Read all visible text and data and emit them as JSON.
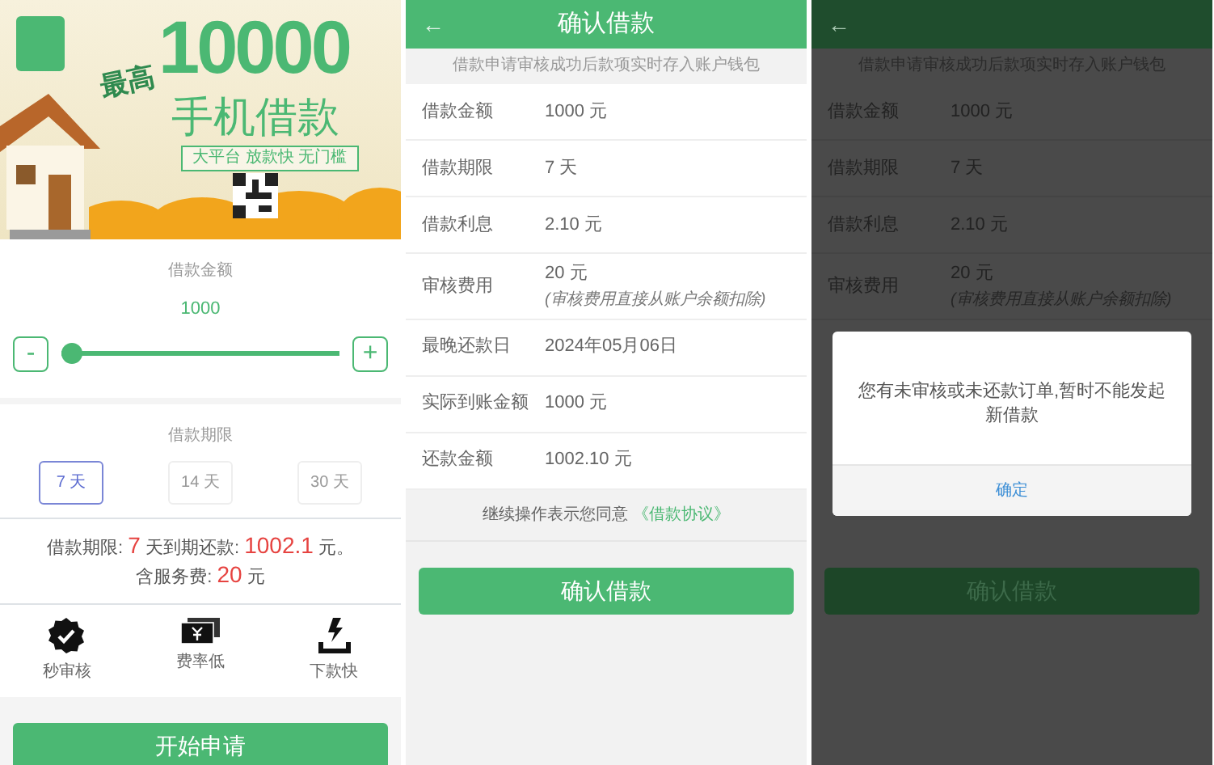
{
  "home": {
    "banner": {
      "prefix": "最高",
      "amount": "10000",
      "headline": "手机借款",
      "tagline": "大平台 放款快 无门槛"
    },
    "amount": {
      "label": "借款金额",
      "value": "1000",
      "minus": "-",
      "plus": "+",
      "level": 0
    },
    "term": {
      "label": "借款期限",
      "options": [
        {
          "label": "7 天",
          "selected": true
        },
        {
          "label": "14 天",
          "selected": false
        },
        {
          "label": "30 天",
          "selected": false
        }
      ]
    },
    "summary": [
      [
        {
          "text": "借款期限: ",
          "highlight": false
        },
        {
          "text": "7",
          "highlight": true
        },
        {
          "text": " 天到期还款: ",
          "highlight": false
        },
        {
          "text": "1002.1",
          "highlight": true
        },
        {
          "text": " 元。",
          "highlight": false
        }
      ],
      [
        {
          "text": "含服务费: ",
          "highlight": false
        },
        {
          "text": "20",
          "highlight": true
        },
        {
          "text": " 元",
          "highlight": false
        }
      ]
    ],
    "features": [
      {
        "kind": "badge",
        "label": "秒审核"
      },
      {
        "kind": "cash",
        "label": "费率低"
      },
      {
        "kind": "bolt",
        "label": "下款快"
      }
    ],
    "apply_button": "开始申请"
  },
  "screens": [
    {
      "dimmed": false,
      "title": "确认借款",
      "back": "←",
      "notice": "借款申请审核成功后款项实时存入账户钱包",
      "rows": [
        {
          "label": "借款金额",
          "value": "1000 元"
        },
        {
          "label": "借款期限",
          "value": "7 天"
        },
        {
          "label": "借款利息",
          "value": "2.10 元"
        },
        {
          "label": "审核费用",
          "value": "20 元",
          "note": "(审核费用直接从账户余额扣除)"
        },
        {
          "label": "最晚还款日",
          "value": "2024年05月06日"
        },
        {
          "label": "实际到账金额",
          "value": "1000 元"
        },
        {
          "label": "还款金额",
          "value": "1002.10 元"
        }
      ],
      "agreement": {
        "text": "继续操作表示您同意",
        "link": "《借款协议》"
      },
      "confirm_button": "确认借款"
    },
    {
      "dimmed": true,
      "back": "←",
      "notice": "借款申请审核成功后款项实时存入账户钱包",
      "rows": [
        {
          "label": "借款金额",
          "value": "1000 元"
        },
        {
          "label": "借款期限",
          "value": "7 天"
        },
        {
          "label": "借款利息",
          "value": "2.10 元"
        },
        {
          "label": "审核费用",
          "value": "20 元",
          "note": "(审核费用直接从账户余额扣除)"
        }
      ],
      "dialog": {
        "message": "您有未审核或未还款订单,暂时不能发起新借款",
        "ok": "确定"
      },
      "confirm_button": "确认借款"
    }
  ]
}
